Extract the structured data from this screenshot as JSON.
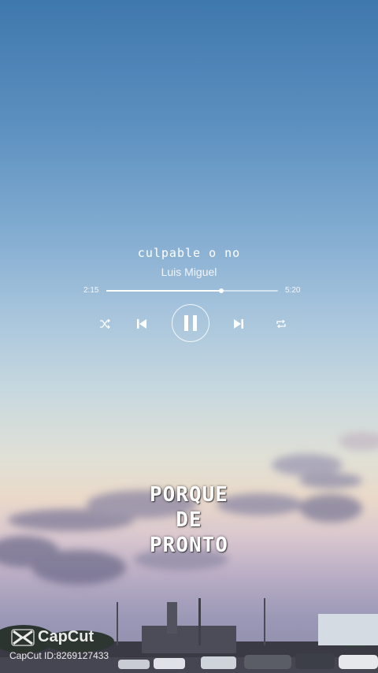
{
  "player": {
    "song_title": "culpable o no",
    "artist": "Luis Miguel",
    "elapsed": "2:15",
    "total": "5:20",
    "progress_fraction": 0.67,
    "state": "playing",
    "controls": {
      "shuffle_icon": "shuffle-icon",
      "previous_icon": "skip-previous-icon",
      "pause_icon": "pause-icon",
      "next_icon": "skip-next-icon",
      "repeat_icon": "repeat-icon"
    }
  },
  "lyrics": {
    "lines": [
      "PORQUE",
      "DE",
      "PRONTO"
    ]
  },
  "watermark": {
    "brand": "CapCut",
    "id_text": "CapCut ID:8269127433",
    "logo_icon": "capcut-logo-icon"
  },
  "colors": {
    "text": "#ffffff",
    "sky_top": "#3f78ad",
    "sky_horizon": "#ead9c9"
  }
}
